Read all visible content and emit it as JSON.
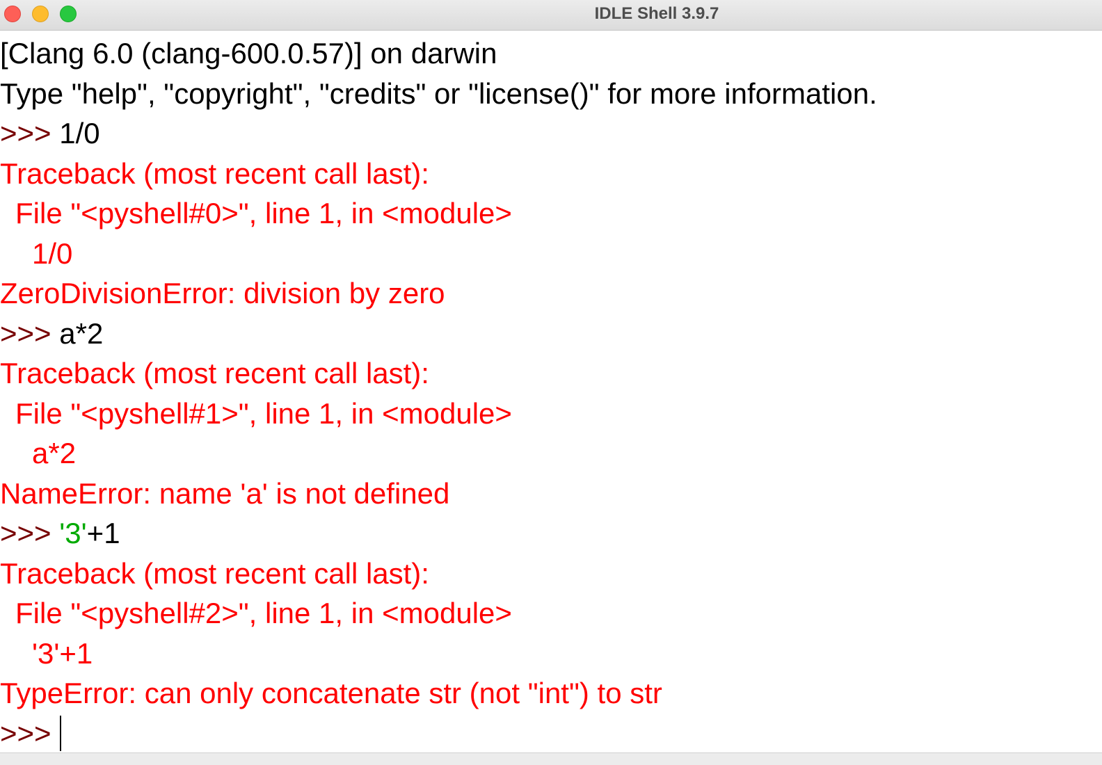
{
  "window": {
    "title": "IDLE Shell 3.9.7"
  },
  "colors": {
    "prompt": "#770000",
    "error": "#ff0000",
    "string": "#00aa00",
    "text": "#000000"
  },
  "shell": {
    "prompt": ">>>",
    "banner": [
      "[Clang 6.0 (clang-600.0.57)] on darwin",
      "Type \"help\", \"copyright\", \"credits\" or \"license()\" for more information."
    ],
    "entries": [
      {
        "input": "1/0",
        "traceback_header": "Traceback (most recent call last):",
        "file_line": "File \"<pyshell#0>\", line 1, in <module>",
        "code_line": "1/0",
        "error": "ZeroDivisionError: division by zero"
      },
      {
        "input": "a*2",
        "traceback_header": "Traceback (most recent call last):",
        "file_line": "File \"<pyshell#1>\", line 1, in <module>",
        "code_line": "a*2",
        "error": "NameError: name 'a' is not defined"
      },
      {
        "input_string": "'3'",
        "input_rest": "+1",
        "traceback_header": "Traceback (most recent call last):",
        "file_line": "File \"<pyshell#2>\", line 1, in <module>",
        "code_line": "'3'+1",
        "error": "TypeError: can only concatenate str (not \"int\") to str"
      }
    ]
  }
}
